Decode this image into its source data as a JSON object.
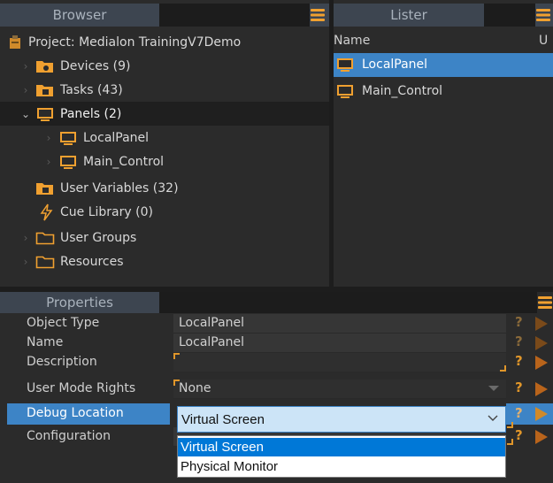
{
  "browser": {
    "title": "Browser",
    "project_label": "Project: Medialon TrainingV7Demo",
    "items": [
      {
        "label": "Devices (9)"
      },
      {
        "label": "Tasks (43)"
      },
      {
        "label": "Panels (2)"
      },
      {
        "label": "LocalPanel"
      },
      {
        "label": "Main_Control"
      },
      {
        "label": "User Variables (32)"
      },
      {
        "label": "Cue Library (0)"
      },
      {
        "label": "User Groups"
      },
      {
        "label": "Resources"
      }
    ]
  },
  "lister": {
    "title": "Lister",
    "columns": [
      "Name",
      "U"
    ],
    "rows": [
      {
        "label": "LocalPanel"
      },
      {
        "label": "Main_Control"
      }
    ]
  },
  "properties": {
    "title": "Properties",
    "rows": [
      {
        "name": "Object Type",
        "value": "LocalPanel"
      },
      {
        "name": "Name",
        "value": "LocalPanel"
      },
      {
        "name": "Description",
        "value": ""
      },
      {
        "name": "User Mode Rights",
        "value": "None"
      },
      {
        "name": "Debug Location",
        "value": "Virtual Screen"
      },
      {
        "name": "Configuration",
        "value": ""
      }
    ],
    "help_glyph": "?",
    "dropdown_options": [
      "Virtual Screen",
      "Physical Monitor"
    ]
  },
  "colors": {
    "accent_orange": "#e0962a",
    "selection_blue": "#3d84c6",
    "header_bg": "#3d4550"
  }
}
